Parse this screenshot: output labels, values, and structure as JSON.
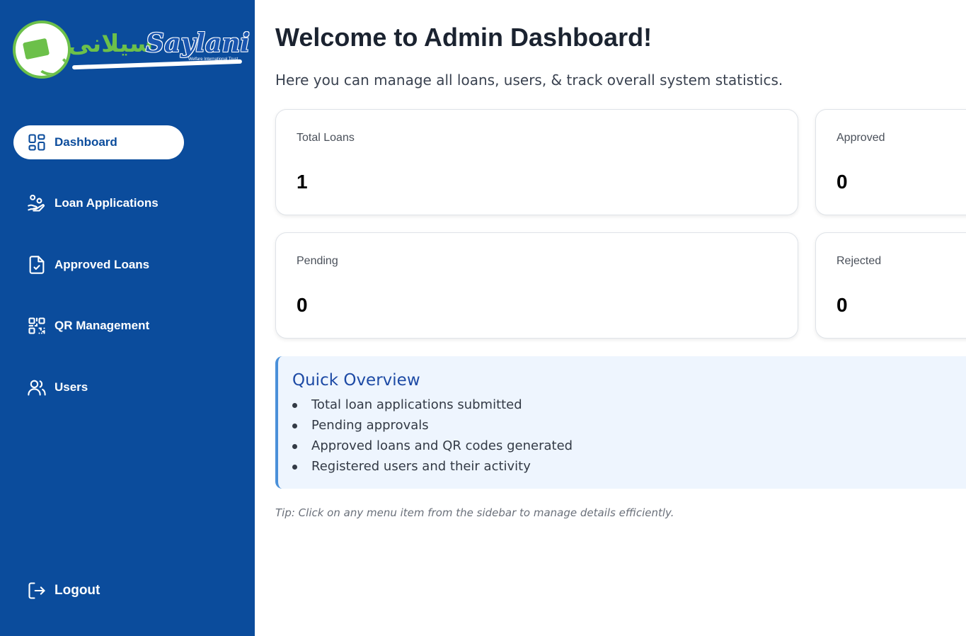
{
  "brand": {
    "name_latin": "Saylani",
    "name_urdu": "سیلانی",
    "tagline": "Welfare International Trust",
    "colors": {
      "sidebar": "#0b4c9c",
      "green": "#6cc04a",
      "accent": "#1d4aa5"
    }
  },
  "sidebar": {
    "items": [
      {
        "label": "Dashboard",
        "icon": "dashboard-grid-icon",
        "active": true
      },
      {
        "label": "Loan Applications",
        "icon": "hand-coins-icon",
        "active": false
      },
      {
        "label": "Approved Loans",
        "icon": "file-check-icon",
        "active": false
      },
      {
        "label": "QR Management",
        "icon": "qr-code-icon",
        "active": false
      },
      {
        "label": "Users",
        "icon": "users-icon",
        "active": false
      }
    ],
    "logout_label": "Logout"
  },
  "main": {
    "title": "Welcome to Admin Dashboard!",
    "subtitle": "Here you can manage all loans, users, & track overall system statistics.",
    "stats": [
      {
        "label": "Total Loans",
        "value": "1"
      },
      {
        "label": "Approved",
        "value": "0"
      },
      {
        "label": "Pending",
        "value": "0"
      },
      {
        "label": "Rejected",
        "value": "0"
      }
    ],
    "overview": {
      "heading": "Quick Overview",
      "items": [
        "Total loan applications submitted",
        "Pending approvals",
        "Approved loans and QR codes generated",
        "Registered users and their activity"
      ]
    },
    "tip": "Tip: Click on any menu item from the sidebar to manage details efficiently."
  }
}
